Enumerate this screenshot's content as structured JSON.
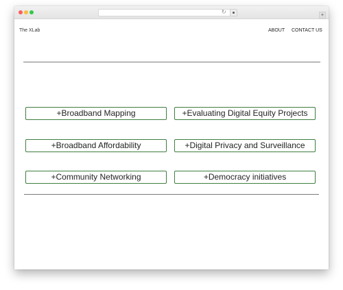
{
  "browser": {
    "reload_glyph": "↻",
    "newtab_glyph": "+"
  },
  "header": {
    "brand": "The XLab",
    "nav": {
      "about": "ABOUT",
      "contact": "CONTACT US"
    }
  },
  "topics": [
    "+Broadband Mapping",
    "+Evaluating Digital Equity Projects",
    "+Broadband Affordability",
    "+Digital Privacy and Surveillance",
    "+Community Networking",
    "+Democracy initiatives"
  ],
  "colors": {
    "button_border": "#3e7d3e",
    "divider": "#7a7a7a",
    "traffic_light_close": "#fc605c",
    "traffic_light_minimize": "#fdbc40",
    "traffic_light_zoom": "#34c84a"
  }
}
